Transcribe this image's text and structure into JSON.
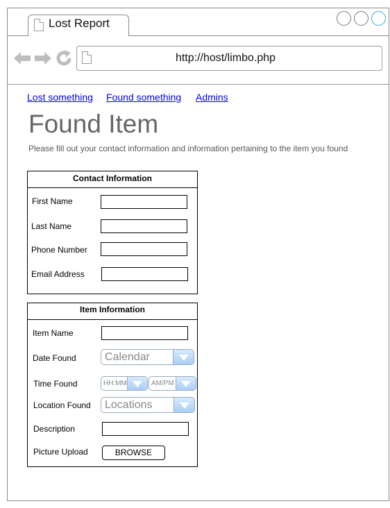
{
  "browser": {
    "tab_title": "Lost Report",
    "address": "http://host/limbo.php",
    "nav_icons": [
      "back-arrow-icon",
      "forward-arrow-icon",
      "refresh-icon"
    ]
  },
  "nav": {
    "links": [
      "Lost something",
      "Found something",
      "Admins"
    ]
  },
  "page": {
    "title": "Found Item",
    "intro": "Please fill out your contact information and information pertaining to the item you found"
  },
  "contact": {
    "heading": "Contact Information",
    "first_name_label": "First Name",
    "first_name_value": "",
    "last_name_label": "Last Name",
    "last_name_value": "",
    "phone_label": "Phone Number",
    "phone_value": "",
    "email_label": "Email Address",
    "email_value": ""
  },
  "item": {
    "heading": "Item Information",
    "name_label": "Item Name",
    "name_value": "",
    "date_label": "Date Found",
    "date_value": "Calendar",
    "time_label": "Time Found",
    "time_value": "HH:MM",
    "ampm_value": "AM/PM",
    "location_label": "Location Found",
    "location_value": "Locations",
    "description_label": "Description",
    "description_value": "",
    "picture_label": "Picture Upload",
    "browse_label": "BROWSE"
  },
  "colors": {
    "link": "#0000ee",
    "heading": "#666666",
    "active_window_button": "#3aa6d8"
  }
}
